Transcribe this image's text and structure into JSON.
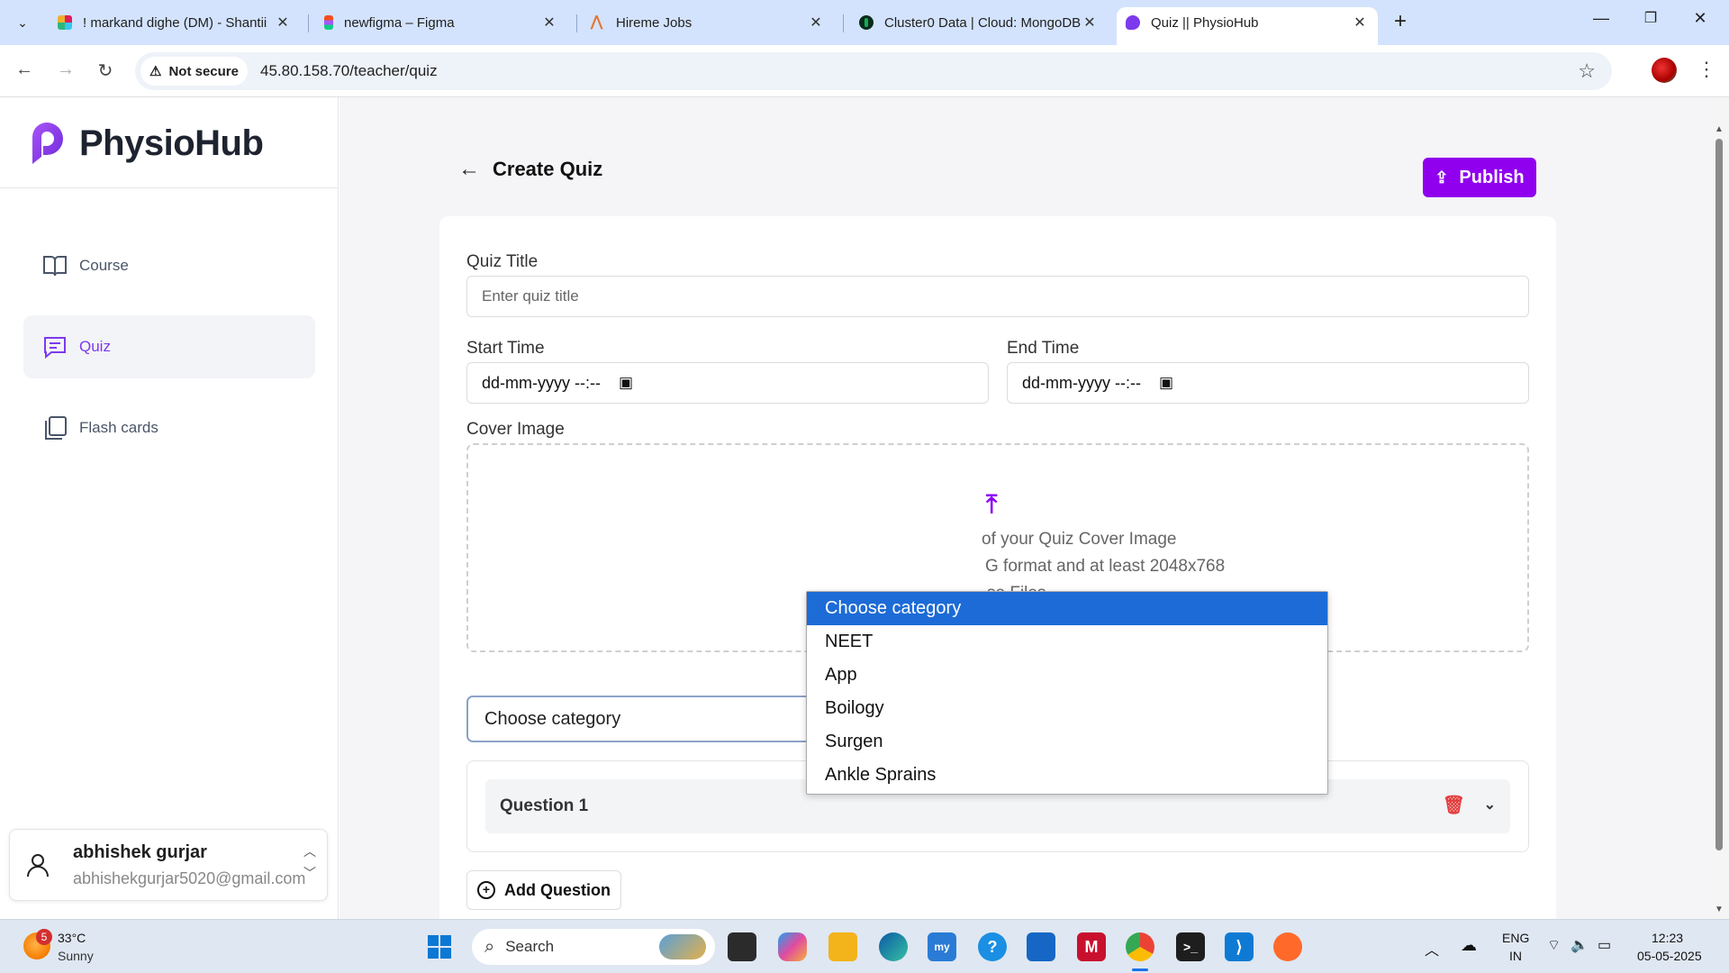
{
  "browser": {
    "tabs": [
      {
        "title": "! markand dighe (DM) - Shantii",
        "favicon_color": "#e01e5a"
      },
      {
        "title": "newfigma – Figma",
        "favicon_color": "#f24e1e"
      },
      {
        "title": "Hireme Jobs",
        "favicon_color": "#e8742b"
      },
      {
        "title": "Cluster0 Data | Cloud: MongoDB",
        "favicon_color": "#0b2b1d"
      },
      {
        "title": "Quiz || PhysioHub",
        "favicon_color": "#7c3aed"
      }
    ],
    "security_label": "Not secure",
    "url": "45.80.158.70/teacher/quiz"
  },
  "sidebar": {
    "brand": "PhysioHub",
    "items": [
      {
        "label": "Course",
        "icon": "book-icon",
        "active": false
      },
      {
        "label": "Quiz",
        "icon": "message-icon",
        "active": true
      },
      {
        "label": "Flash cards",
        "icon": "cards-icon",
        "active": false
      }
    ],
    "user": {
      "name": "abhishek gurjar",
      "email": "abhishekgurjar5020@gmail.com"
    }
  },
  "main": {
    "title": "Create Quiz",
    "publish_label": "Publish",
    "quiz_title_label": "Quiz Title",
    "quiz_title_placeholder": "Enter quiz title",
    "start_time_label": "Start Time",
    "start_time_value": "dd-mm-yyyy --:--",
    "end_time_label": "End Time",
    "end_time_value": "dd-mm-yyyy --:--",
    "cover_image_label": "Cover Image",
    "cover_line1": "of your Quiz Cover Image",
    "cover_line2": "G format and at least 2048x768",
    "cover_line3": "se Files",
    "category_selected": "Choose category",
    "category_options": [
      "Choose category",
      "NEET",
      "App",
      "Boilogy",
      "Surgen",
      "Ankle Sprains"
    ],
    "question_title": "Question 1",
    "add_question_label": "Add Question"
  },
  "taskbar": {
    "weather_badge": "5",
    "temperature": "33°C",
    "condition": "Sunny",
    "search_label": "Search",
    "language": "ENG",
    "region": "IN",
    "time": "12:23",
    "date": "05-05-2025"
  },
  "colors": {
    "accent": "#8b00f5",
    "active_sidebar_text": "#7c3aed",
    "dropdown_highlight": "#1d6bd6",
    "delete_red": "#e53e3e"
  }
}
